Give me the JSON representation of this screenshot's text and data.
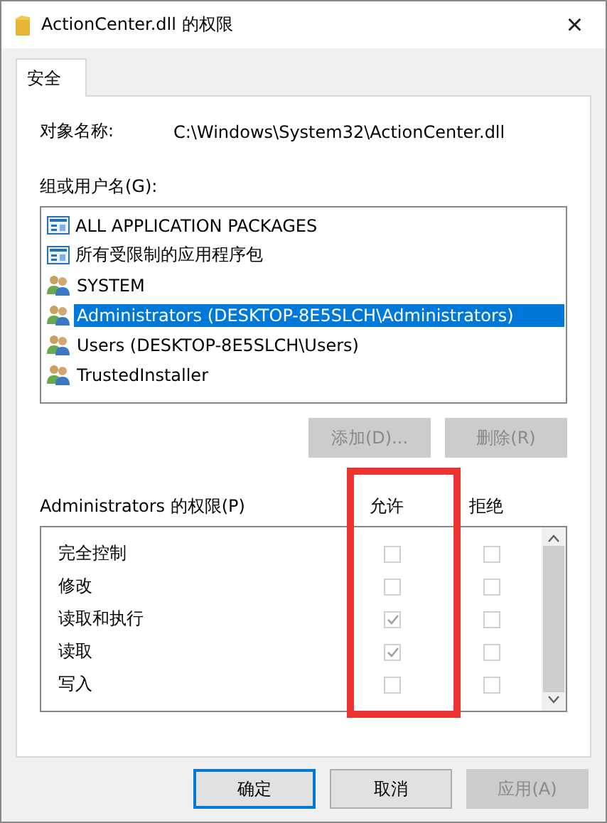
{
  "window": {
    "title": "ActionCenter.dll 的权限",
    "close": "×"
  },
  "tabs": [
    {
      "label": "安全",
      "selected": true
    }
  ],
  "object_name": {
    "label": "对象名称:",
    "value": "C:\\Windows\\System32\\ActionCenter.dll"
  },
  "groups": {
    "label": "组或用户名(G):",
    "items": [
      {
        "name": "ALL APPLICATION PACKAGES",
        "kind": "package",
        "selected": false
      },
      {
        "name": "所有受限制的应用程序包",
        "kind": "package",
        "selected": false
      },
      {
        "name": "SYSTEM",
        "kind": "users",
        "selected": false
      },
      {
        "name": "Administrators (DESKTOP-8E5SLCH\\Administrators)",
        "kind": "users",
        "selected": true
      },
      {
        "name": "Users (DESKTOP-8E5SLCH\\Users)",
        "kind": "users",
        "selected": false
      },
      {
        "name": "TrustedInstaller",
        "kind": "users",
        "selected": false
      }
    ]
  },
  "group_buttons": [
    {
      "label": "添加(D)...",
      "disabled": true
    },
    {
      "label": "删除(R)",
      "disabled": true
    }
  ],
  "permissions": {
    "label": "Administrators 的权限(P)",
    "allow_header": "允许",
    "deny_header": "拒绝",
    "rows": [
      {
        "name": "完全控制",
        "allow": false,
        "deny": false
      },
      {
        "name": "修改",
        "allow": false,
        "deny": false
      },
      {
        "name": "读取和执行",
        "allow": true,
        "deny": false
      },
      {
        "name": "读取",
        "allow": true,
        "deny": false
      },
      {
        "name": "写入",
        "allow": false,
        "deny": false
      }
    ]
  },
  "buttons": [
    {
      "label": "确定",
      "default": true,
      "disabled": false
    },
    {
      "label": "取消",
      "default": false,
      "disabled": false
    },
    {
      "label": "应用(A)",
      "default": false,
      "disabled": true
    }
  ]
}
